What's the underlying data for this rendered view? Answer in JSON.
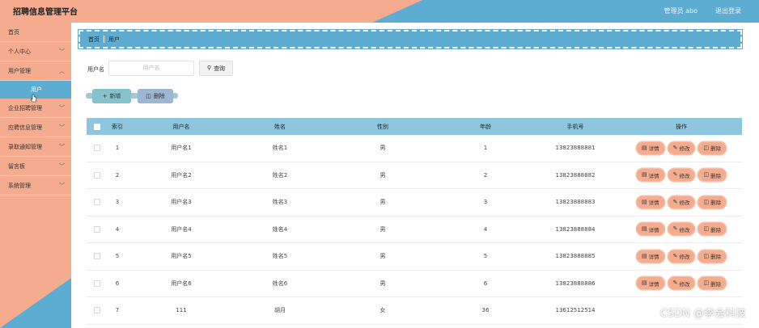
{
  "header": {
    "title": "招聘信息管理平台",
    "user": "管理员 abo",
    "logout": "退出登录"
  },
  "sidebar": {
    "items": [
      {
        "label": "首页",
        "chevron": false
      },
      {
        "label": "个人中心",
        "chevron": true
      },
      {
        "label": "用户管理",
        "chevron": true
      },
      {
        "label": "企业招聘管理",
        "chevron": true
      },
      {
        "label": "应聘信息管理",
        "chevron": true
      },
      {
        "label": "录取通知管理",
        "chevron": true
      },
      {
        "label": "留言板",
        "chevron": true
      },
      {
        "label": "系统管理",
        "chevron": true
      }
    ],
    "sub_item": "用户"
  },
  "breadcrumb": {
    "home": "首页",
    "current": "用户"
  },
  "search": {
    "label": "用户名",
    "placeholder": "用户名",
    "button": "查询"
  },
  "actions": {
    "add": "新增",
    "delete": "删除"
  },
  "table": {
    "headers": [
      "索引",
      "用户名",
      "姓名",
      "性别",
      "年龄",
      "手机号",
      "操作"
    ],
    "op_labels": {
      "detail": "详情",
      "edit": "修改",
      "delete": "删除"
    },
    "rows": [
      {
        "idx": "1",
        "user": "用户名1",
        "name": "姓名1",
        "gender": "男",
        "age": "1",
        "phone": "13823888881"
      },
      {
        "idx": "2",
        "user": "用户名2",
        "name": "姓名2",
        "gender": "男",
        "age": "2",
        "phone": "13823888882"
      },
      {
        "idx": "3",
        "user": "用户名3",
        "name": "姓名3",
        "gender": "男",
        "age": "3",
        "phone": "13823888883"
      },
      {
        "idx": "4",
        "user": "用户名4",
        "name": "姓名4",
        "gender": "男",
        "age": "4",
        "phone": "13823888884"
      },
      {
        "idx": "5",
        "user": "用户名5",
        "name": "姓名5",
        "gender": "男",
        "age": "5",
        "phone": "13823888885"
      },
      {
        "idx": "6",
        "user": "用户名6",
        "name": "姓名6",
        "gender": "男",
        "age": "6",
        "phone": "13823888886"
      },
      {
        "idx": "7",
        "user": "111",
        "name": "胡月",
        "gender": "女",
        "age": "36",
        "phone": "13612512514"
      }
    ]
  },
  "watermark": "CSDN @李会科技",
  "colors": {
    "accent_blue": "#5dadd3",
    "accent_salmon": "#f5ac8e",
    "table_header": "#8ec6df"
  }
}
